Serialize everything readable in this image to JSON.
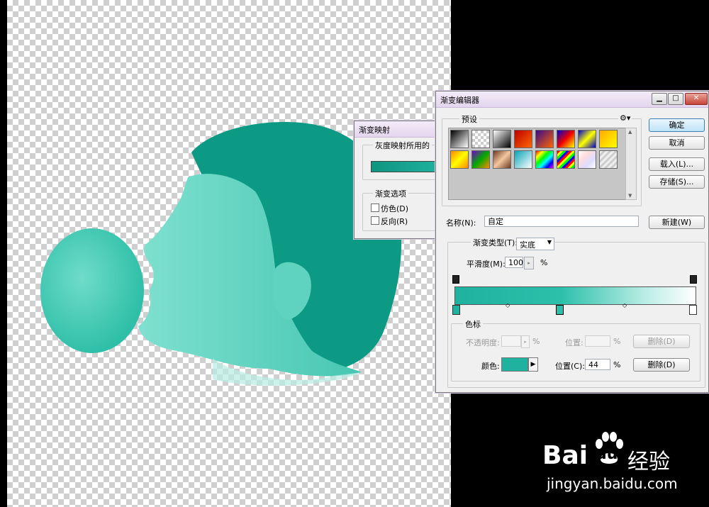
{
  "colors": {
    "teal": "#1fb39f",
    "teal_dark": "#0f9580",
    "teal_light": "#5fd3c0",
    "white": "#ffffff"
  },
  "gradient_map": {
    "title": "渐变映射",
    "group_label": "灰度映射所用的",
    "options_label": "渐变选项",
    "dither_label": "仿色(D)",
    "reverse_label": "反向(R)"
  },
  "editor": {
    "title": "渐变编辑器",
    "presets_label": "预设",
    "gear_icon": "gear-icon",
    "buttons": {
      "ok": "确定",
      "cancel": "取消",
      "load": "载入(L)...",
      "save": "存储(S)...",
      "new": "新建(W)"
    },
    "name_label": "名称(N):",
    "name_value": "自定",
    "type_label": "渐变类型(T):",
    "type_value": "实底",
    "smooth_label": "平滑度(M):",
    "smooth_value": "100",
    "smooth_unit": "%",
    "stops_label": "色标",
    "opacity_label": "不透明度:",
    "opacity_unit": "%",
    "position_label": "位置:",
    "position_unit": "%",
    "delete_label": "删除(D)",
    "color_label": "颜色:",
    "color_position_label": "位置(C):",
    "color_position_value": "44",
    "color_position_unit": "%",
    "presets": [
      "black-white",
      "fg-transparent",
      "black-white-2",
      "red-orange",
      "violet-orange",
      "blue-red-yellow",
      "blue-yellow-blue",
      "yellow-orange",
      "orange-yellow",
      "violet-green-orange",
      "copper",
      "teal-white",
      "spectrum",
      "rainbow-stripe",
      "transparent-rainbow",
      "transparent-stripes"
    ]
  },
  "watermark": {
    "brand_left": "Bai",
    "brand_right": "du",
    "product": "经验",
    "url": "jingyan.baidu.com"
  }
}
